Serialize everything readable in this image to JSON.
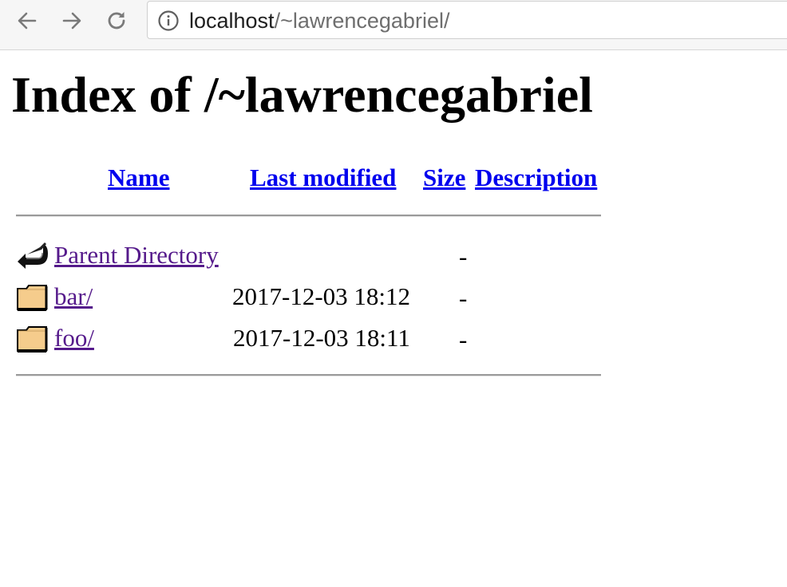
{
  "browser": {
    "url_host": "localhost",
    "url_path": "/~lawrencegabriel/",
    "icons": [
      "back-arrow-icon",
      "forward-arrow-icon",
      "reload-icon",
      "info-icon"
    ]
  },
  "page": {
    "title": "Index of /~lawrencegabriel",
    "columns": {
      "name": "Name",
      "last_modified": "Last modified",
      "size": "Size",
      "description": "Description"
    },
    "rows": [
      {
        "icon": "parent-directory-icon",
        "name": "Parent Directory",
        "modified": "",
        "size": "-",
        "description": ""
      },
      {
        "icon": "folder-icon",
        "name": "bar/",
        "modified": "2017-12-03 18:12",
        "size": "-",
        "description": ""
      },
      {
        "icon": "folder-icon",
        "name": "foo/",
        "modified": "2017-12-03 18:11",
        "size": "-",
        "description": ""
      }
    ]
  },
  "colors": {
    "link": "#0000ee",
    "visited_link": "#551a8b",
    "folder": "#f5cc8c"
  }
}
